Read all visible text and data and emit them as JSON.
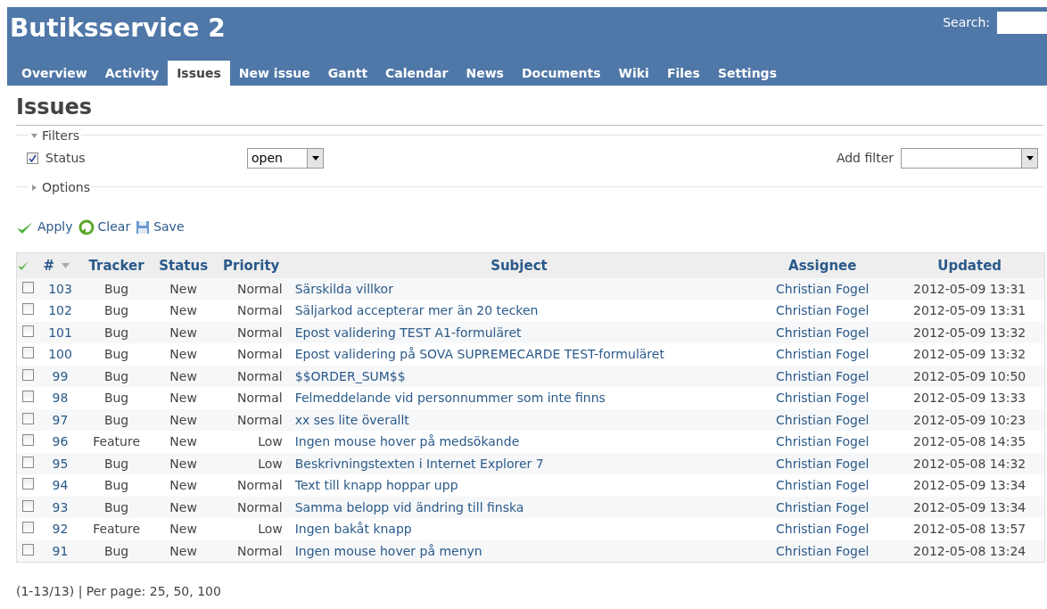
{
  "header": {
    "title": "Butiksservice 2",
    "search_label": "Search:"
  },
  "tabs": [
    {
      "label": "Overview",
      "selected": false
    },
    {
      "label": "Activity",
      "selected": false
    },
    {
      "label": "Issues",
      "selected": true
    },
    {
      "label": "New issue",
      "selected": false
    },
    {
      "label": "Gantt",
      "selected": false
    },
    {
      "label": "Calendar",
      "selected": false
    },
    {
      "label": "News",
      "selected": false
    },
    {
      "label": "Documents",
      "selected": false
    },
    {
      "label": "Wiki",
      "selected": false
    },
    {
      "label": "Files",
      "selected": false
    },
    {
      "label": "Settings",
      "selected": false
    }
  ],
  "page_title": "Issues",
  "filters": {
    "legend": "Filters",
    "expanded": true,
    "status": {
      "label": "Status",
      "checked": true,
      "value": "open"
    },
    "add_filter_label": "Add filter"
  },
  "options": {
    "legend": "Options",
    "expanded": false
  },
  "actions": [
    "Apply",
    "Clear",
    "Save"
  ],
  "table": {
    "columns": [
      "#",
      "Tracker",
      "Status",
      "Priority",
      "Subject",
      "Assignee",
      "Updated"
    ],
    "rows": [
      {
        "checked": false,
        "cells": [
          "103",
          "Bug",
          "New",
          "Normal",
          "Särskilda villkor",
          "Christian Fogel",
          "2012-05-09 13:31"
        ]
      },
      {
        "checked": false,
        "cells": [
          "102",
          "Bug",
          "New",
          "Normal",
          "Säljarkod accepterar mer än 20 tecken",
          "Christian Fogel",
          "2012-05-09 13:31"
        ]
      },
      {
        "checked": false,
        "cells": [
          "101",
          "Bug",
          "New",
          "Normal",
          "Epost validering TEST A1-formuläret",
          "Christian Fogel",
          "2012-05-09 13:32"
        ]
      },
      {
        "checked": false,
        "cells": [
          "100",
          "Bug",
          "New",
          "Normal",
          "Epost validering på SOVA SUPREMECARDE TEST-formuläret",
          "Christian Fogel",
          "2012-05-09 13:32"
        ]
      },
      {
        "checked": false,
        "cells": [
          "99",
          "Bug",
          "New",
          "Normal",
          "$$ORDER_SUM$$",
          "Christian Fogel",
          "2012-05-09 10:50"
        ]
      },
      {
        "checked": false,
        "cells": [
          "98",
          "Bug",
          "New",
          "Normal",
          "Felmeddelande vid personnummer som inte finns",
          "Christian Fogel",
          "2012-05-09 13:33"
        ]
      },
      {
        "checked": false,
        "cells": [
          "97",
          "Bug",
          "New",
          "Normal",
          "xx ses lite överallt",
          "Christian Fogel",
          "2012-05-09 10:23"
        ]
      },
      {
        "checked": false,
        "cells": [
          "96",
          "Feature",
          "New",
          "Low",
          "Ingen mouse hover på medsökande",
          "Christian Fogel",
          "2012-05-08 14:35"
        ]
      },
      {
        "checked": false,
        "cells": [
          "95",
          "Bug",
          "New",
          "Low",
          "Beskrivningstexten i Internet Explorer 7",
          "Christian Fogel",
          "2012-05-08 14:32"
        ]
      },
      {
        "checked": false,
        "cells": [
          "94",
          "Bug",
          "New",
          "Normal",
          "Text till knapp hoppar upp",
          "Christian Fogel",
          "2012-05-09 13:34"
        ]
      },
      {
        "checked": false,
        "cells": [
          "93",
          "Bug",
          "New",
          "Normal",
          "Samma belopp vid ändring till finska",
          "Christian Fogel",
          "2012-05-09 13:34"
        ]
      },
      {
        "checked": false,
        "cells": [
          "92",
          "Feature",
          "New",
          "Low",
          "Ingen bakåt knapp",
          "Christian Fogel",
          "2012-05-08 13:57"
        ]
      },
      {
        "checked": false,
        "cells": [
          "91",
          "Bug",
          "New",
          "Normal",
          "Ingen mouse hover på menyn",
          "Christian Fogel",
          "2012-05-08 13:24"
        ]
      }
    ]
  },
  "pagination": "(1-13/13) | Per page: 25, 50, 100"
}
